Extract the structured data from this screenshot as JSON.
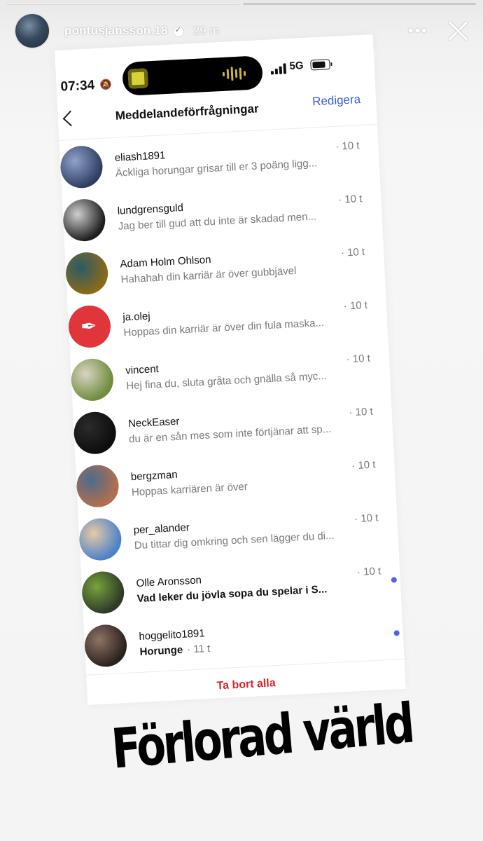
{
  "story": {
    "username": "pontusjansson.18",
    "time": "29 m",
    "more_icon": "ellipsis-icon",
    "close_icon": "close-icon"
  },
  "screenshot": {
    "status": {
      "time": "07:34",
      "network": "5G"
    },
    "nav": {
      "title": "Meddelandeförfrågningar",
      "edit": "Redigera"
    },
    "requests": [
      {
        "name": "eliash1891",
        "preview": "Äckliga horungar grisar till er 3 poäng ligg...",
        "time": "· 10 t",
        "unread": false,
        "avatar": [
          "#2f3d63",
          "#8fa2c9"
        ]
      },
      {
        "name": "lundgrensguld",
        "preview": "Jag ber till gud att du inte är skadad men...",
        "time": "· 10 t",
        "unread": false,
        "avatar": [
          "#1e1e1e",
          "#cfcfcf"
        ]
      },
      {
        "name": "Adam Holm Ohlson",
        "preview": "Hahahah din karriär är över gubbjävel",
        "time": "· 10 t",
        "unread": false,
        "avatar": [
          "#8a6a18",
          "#2a5a6a"
        ]
      },
      {
        "name": "ja.olej",
        "preview": "Hoppas din karriär är över din fula maska...",
        "time": "· 10 t",
        "unread": false,
        "avatar": [
          "#e0353a",
          "#e0353a"
        ]
      },
      {
        "name": "vincent",
        "preview": "Hej fina du, sluta gråta och gnälla så myc...",
        "time": "· 10 t",
        "unread": false,
        "avatar": [
          "#6f8d3e",
          "#d9d4c2"
        ]
      },
      {
        "name": "NeckEaser",
        "preview": "du är en sån mes som inte förtjänar att sp...",
        "time": "· 10 t",
        "unread": false,
        "avatar": [
          "#0d0d0d",
          "#2b2b2b"
        ]
      },
      {
        "name": "bergzman",
        "preview": "Hoppas karriären är över",
        "time": "· 10 t",
        "unread": false,
        "avatar": [
          "#b56e4c",
          "#4b6b8e"
        ]
      },
      {
        "name": "per_alander",
        "preview": "Du tittar dig omkring och sen lägger du di...",
        "time": "· 10 t",
        "unread": false,
        "avatar": [
          "#4b82c8",
          "#e8c9a8"
        ]
      },
      {
        "name": "Olle Aronsson",
        "preview": "Vad leker du jövla sopa du spelar i S...",
        "time": "· 10 t",
        "unread": true,
        "avatar": [
          "#2d3a28",
          "#77a33c"
        ]
      },
      {
        "name": "hoggelito1891",
        "preview": "Horunge",
        "time": "· 11 t",
        "unread": true,
        "avatar": [
          "#2a211d",
          "#8e7365"
        ]
      }
    ],
    "delete_all": "Ta bort alla"
  },
  "caption": "Förlorad värld",
  "colors": {
    "link_blue": "#3b5de0",
    "delete_red": "#d3262e",
    "unread_dot": "#4a64e6"
  }
}
